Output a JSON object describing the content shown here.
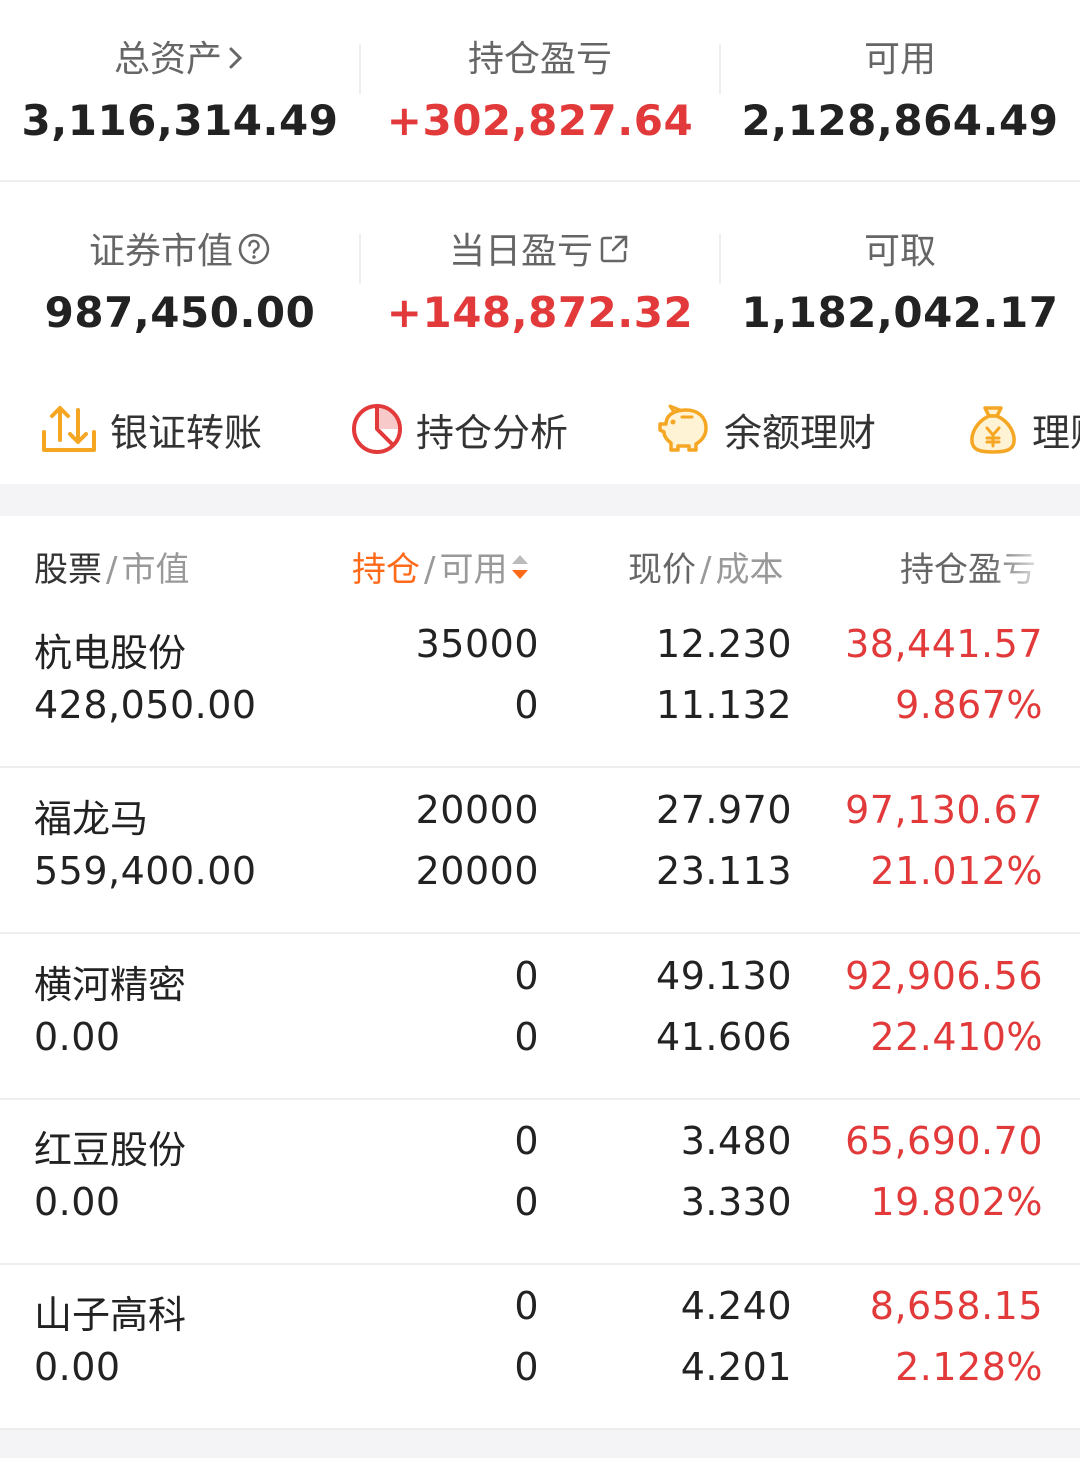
{
  "summary": {
    "total_assets": {
      "label": "总资产",
      "value": "3,116,314.49"
    },
    "position_pl": {
      "label": "持仓盈亏",
      "value": "+302,827.64"
    },
    "available": {
      "label": "可用",
      "value": "2,128,864.49"
    },
    "market_value": {
      "label": "证券市值",
      "value": "987,450.00"
    },
    "daily_pl": {
      "label": "当日盈亏",
      "value": "+148,872.32"
    },
    "withdrawable": {
      "label": "可取",
      "value": "1,182,042.17"
    }
  },
  "shortcuts": [
    {
      "label": "银证转账",
      "icon": "transfer-icon"
    },
    {
      "label": "持仓分析",
      "icon": "pie-chart-icon"
    },
    {
      "label": "余额理财",
      "icon": "piggy-bank-icon"
    },
    {
      "label": "理财",
      "icon": "money-bag-icon"
    }
  ],
  "table": {
    "headers": {
      "stock": "股票",
      "market_value": "市值",
      "position": "持仓",
      "available": "可用",
      "price": "现价",
      "cost": "成本",
      "pl": "持仓盈亏"
    },
    "rows": [
      {
        "name": "杭电股份",
        "market_value": "428,050.00",
        "position": "35000",
        "available": "0",
        "price": "12.230",
        "cost": "11.132",
        "pl": "38,441.57",
        "pl_pct": "9.867%"
      },
      {
        "name": "福龙马",
        "market_value": "559,400.00",
        "position": "20000",
        "available": "20000",
        "price": "27.970",
        "cost": "23.113",
        "pl": "97,130.67",
        "pl_pct": "21.012%"
      },
      {
        "name": "横河精密",
        "market_value": "0.00",
        "position": "0",
        "available": "0",
        "price": "49.130",
        "cost": "41.606",
        "pl": "92,906.56",
        "pl_pct": "22.410%"
      },
      {
        "name": "红豆股份",
        "market_value": "0.00",
        "position": "0",
        "available": "0",
        "price": "3.480",
        "cost": "3.330",
        "pl": "65,690.70",
        "pl_pct": "19.802%"
      },
      {
        "name": "山子高科",
        "market_value": "0.00",
        "position": "0",
        "available": "0",
        "price": "4.240",
        "cost": "4.201",
        "pl": "8,658.15",
        "pl_pct": "2.128%"
      }
    ]
  },
  "colors": {
    "gain": "#e23a3a",
    "accent": "#ff6a1a",
    "icon_orange": "#f5a623"
  }
}
